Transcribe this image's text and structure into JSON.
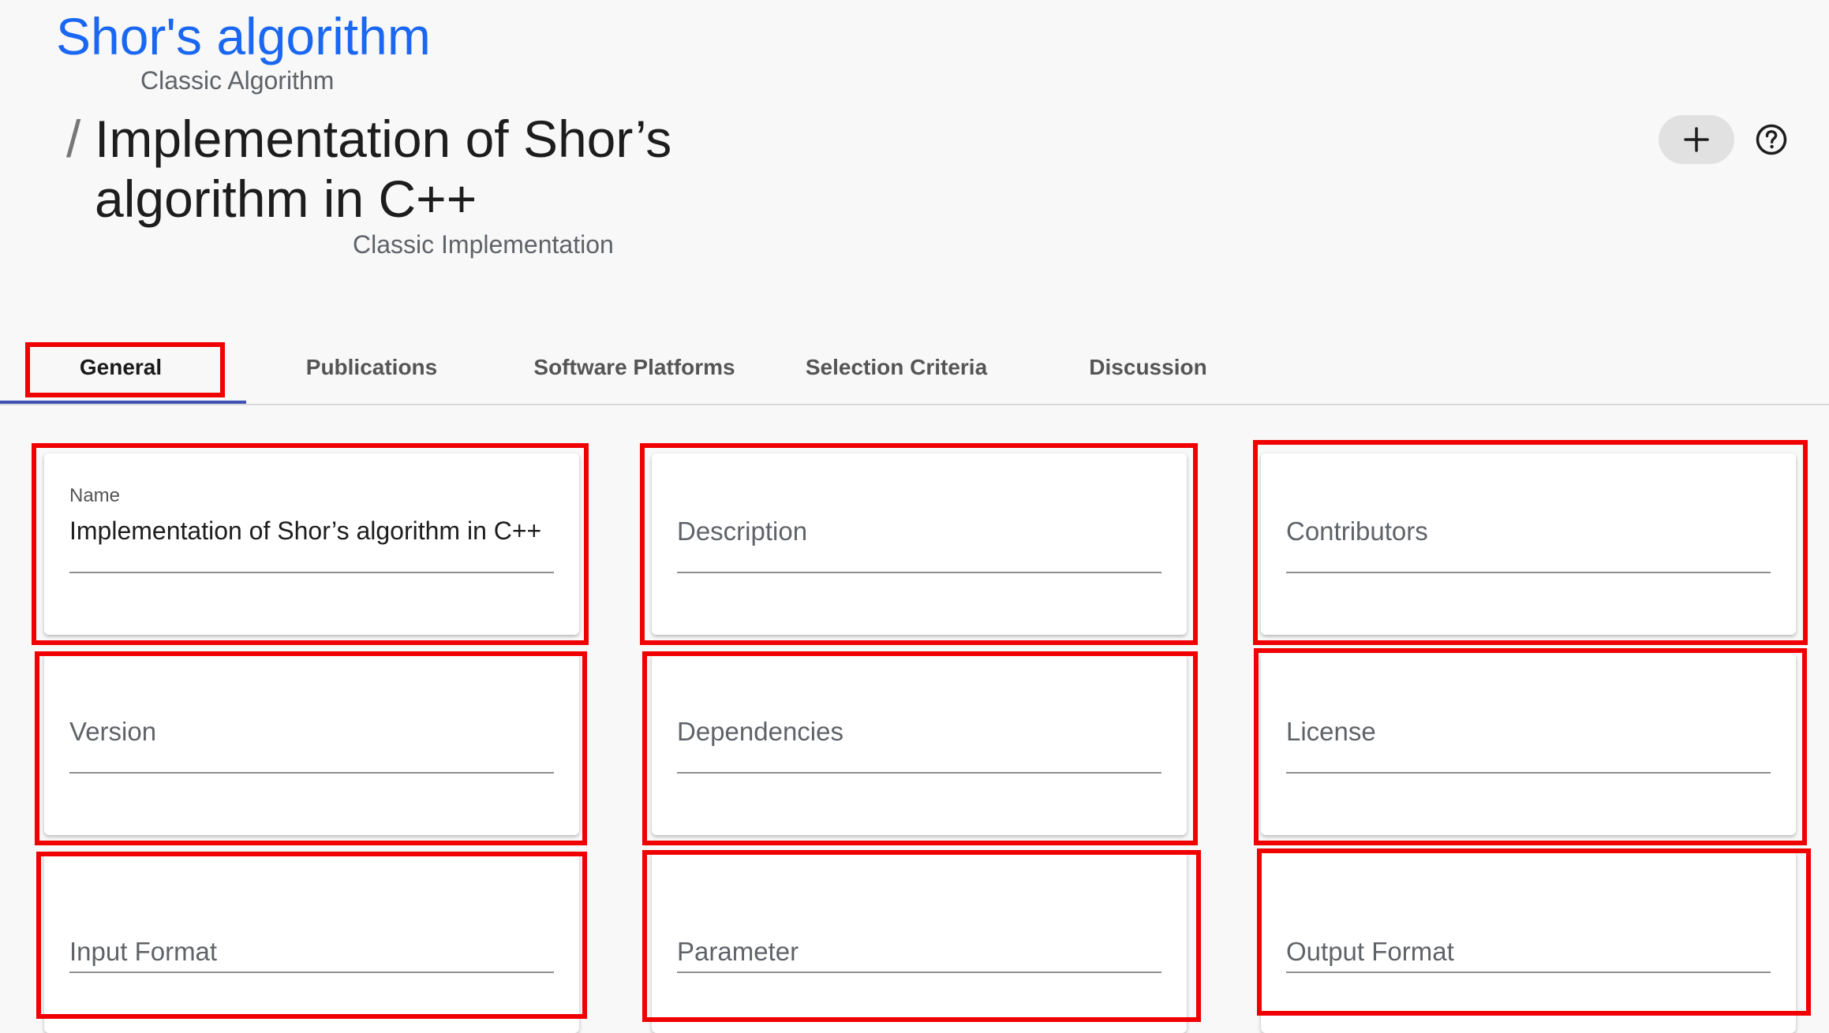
{
  "header": {
    "algorithm_title": "Shor's algorithm",
    "algorithm_type": "Classic Algorithm",
    "breadcrumb_separator": "/",
    "implementation_title_line1": "Implementation of Shor’s",
    "implementation_title_line2": "algorithm in C++",
    "implementation_type": "Classic Implementation"
  },
  "toolbar": {
    "add_icon": "plus-icon",
    "help_icon": "help-circle-icon"
  },
  "tabs": [
    {
      "label": "General",
      "active": true
    },
    {
      "label": "Publications",
      "active": false
    },
    {
      "label": "Software Platforms",
      "active": false
    },
    {
      "label": "Selection Criteria",
      "active": false
    },
    {
      "label": "Discussion",
      "active": false
    }
  ],
  "fields": {
    "name": {
      "label": "Name",
      "value": "Implementation of Shor’s algorithm in C++"
    },
    "description": {
      "placeholder": "Description"
    },
    "contributors": {
      "placeholder": "Contributors"
    },
    "version": {
      "placeholder": "Version"
    },
    "dependencies": {
      "placeholder": "Dependencies"
    },
    "license": {
      "placeholder": "License"
    },
    "input_format": {
      "placeholder": "Input Format"
    },
    "parameter": {
      "placeholder": "Parameter"
    },
    "output_format": {
      "placeholder": "Output Format"
    }
  },
  "colors": {
    "link_blue": "#1967f2",
    "highlight_red": "#f00000",
    "tab_underline": "#3f51b5",
    "background": "#f8f8f8"
  }
}
